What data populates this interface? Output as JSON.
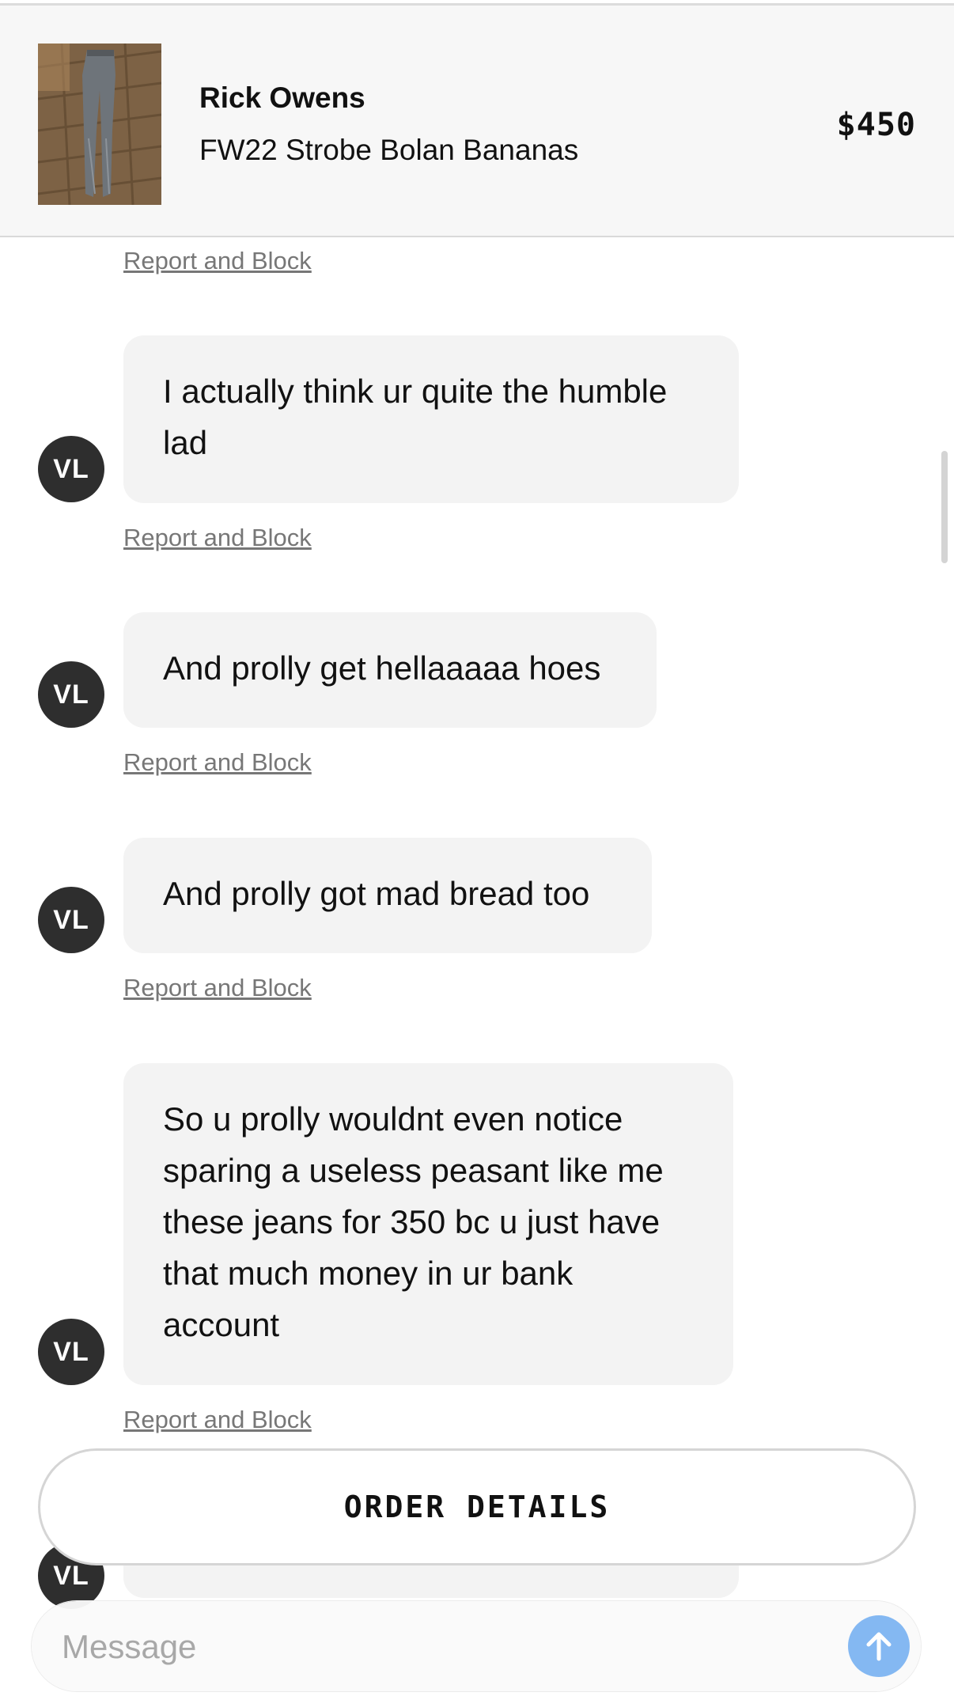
{
  "product": {
    "brand": "Rick Owens",
    "name": "FW22 Strobe Bolan Bananas",
    "price": "$450"
  },
  "report_label": "Report and Block",
  "messages": [
    {
      "avatar": "VL",
      "text": "I actually think ur quite the humble lad"
    },
    {
      "avatar": "VL",
      "text": "And prolly get hellaaaaa hoes"
    },
    {
      "avatar": "VL",
      "text": "And prolly got mad bread too"
    },
    {
      "avatar": "VL",
      "text": "So u prolly wouldnt even notice sparing a useless peasant like me these jeans for 350 bc u just have that much money in ur bank account"
    },
    {
      "avatar": "VL",
      "text": ""
    }
  ],
  "order_details_label": "ORDER DETAILS",
  "composer": {
    "placeholder": "Message"
  },
  "icons": {
    "send": "arrow-up-icon"
  },
  "colors": {
    "send_button": "#84b8f2",
    "avatar_bg": "#2e2e2e",
    "bubble_bg": "#f3f3f3"
  }
}
